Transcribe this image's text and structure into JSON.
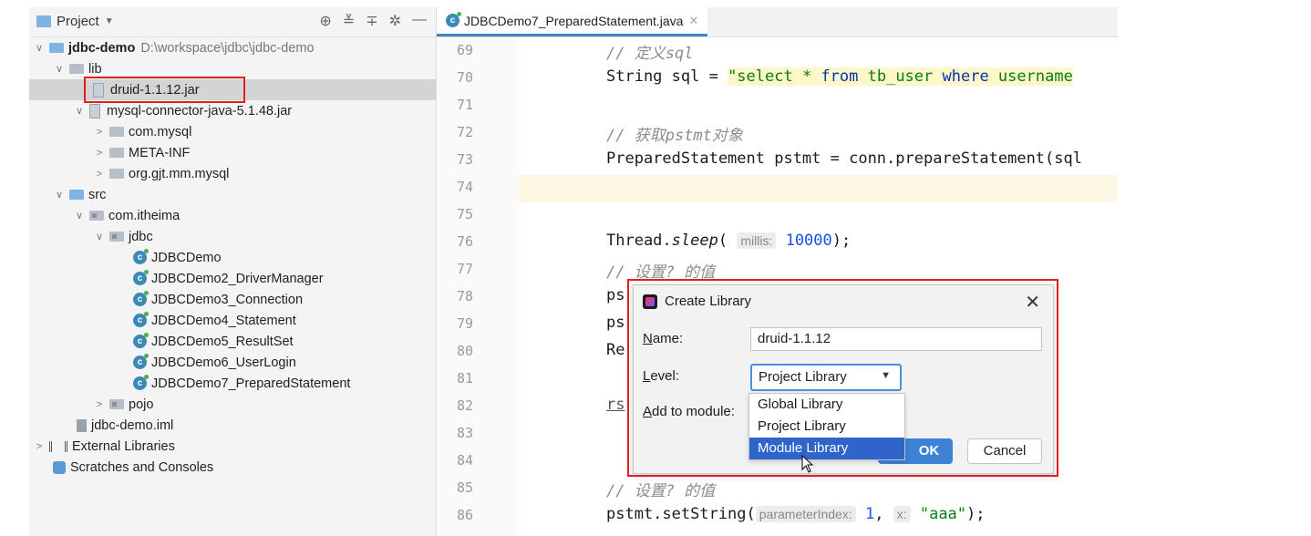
{
  "project_panel": {
    "title": "Project",
    "tool_icons": [
      "globe-icon",
      "collapse-icon",
      "expand-icon",
      "gear-icon",
      "minimize-icon"
    ],
    "tree": [
      {
        "label": "jdbc-demo",
        "path": "D:\\workspace\\jdbc\\jdbc-demo"
      },
      {
        "label": "lib"
      },
      {
        "label": "druid-1.1.12.jar"
      },
      {
        "label": "mysql-connector-java-5.1.48.jar"
      },
      {
        "label": "com.mysql"
      },
      {
        "label": "META-INF"
      },
      {
        "label": "org.gjt.mm.mysql"
      },
      {
        "label": "src"
      },
      {
        "label": "com.itheima"
      },
      {
        "label": "jdbc"
      },
      {
        "label": "JDBCDemo"
      },
      {
        "label": "JDBCDemo2_DriverManager"
      },
      {
        "label": "JDBCDemo3_Connection"
      },
      {
        "label": "JDBCDemo4_Statement"
      },
      {
        "label": "JDBCDemo5_ResultSet"
      },
      {
        "label": "JDBCDemo6_UserLogin"
      },
      {
        "label": "JDBCDemo7_PreparedStatement"
      },
      {
        "label": "pojo"
      },
      {
        "label": "jdbc-demo.iml"
      },
      {
        "label": "External Libraries"
      },
      {
        "label": "Scratches and Consoles"
      }
    ]
  },
  "editor": {
    "tab_label": "JDBCDemo7_PreparedStatement.java",
    "line_numbers": [
      "69",
      "70",
      "71",
      "72",
      "73",
      "74",
      "75",
      "76",
      "77",
      "78",
      "79",
      "80",
      "81",
      "82",
      "83",
      "84",
      "85",
      "86"
    ],
    "code": {
      "l69": "// 定义sql",
      "l70_a": "String sql = ",
      "l70_b": "\"select * ",
      "l70_c": "from",
      "l70_d": " tb_user ",
      "l70_e": "where",
      "l70_f": " username",
      "l72": "// 获取pstmt对象",
      "l73": "PreparedStatement pstmt = conn.prepareStatement(sql",
      "l76_a": "Thread.",
      "l76_b": "sleep",
      "l76_c": "( ",
      "l76_hint": "millis:",
      "l76_num": "10000",
      "l76_d": ");",
      "l77": "// 设置? 的值",
      "l78": "ps",
      "l79": "ps",
      "l80": "Re",
      "l82": "rs",
      "l85": "// 设置? 的值",
      "l86_a": "pstmt.setString(",
      "l86_hint1": "parameterIndex:",
      "l86_num": "1",
      "l86_hint2": "x:",
      "l86_str": "\"aaa\"",
      "l86_b": ");"
    }
  },
  "dialog": {
    "title": "Create Library",
    "name_label_u": "N",
    "name_label_rest": "ame:",
    "name_value": "druid-1.1.12",
    "level_label_u": "L",
    "level_label_rest": "evel:",
    "level_value": "Project Library",
    "module_label_u": "A",
    "module_label_rest": "dd to module:",
    "options": [
      "Global Library",
      "Project Library",
      "Module Library"
    ],
    "ok_label": "OK",
    "cancel_label": "Cancel"
  },
  "colors": {
    "highlight": "#e02020",
    "selection": "#2f65ca",
    "accent": "#3e82d6"
  }
}
